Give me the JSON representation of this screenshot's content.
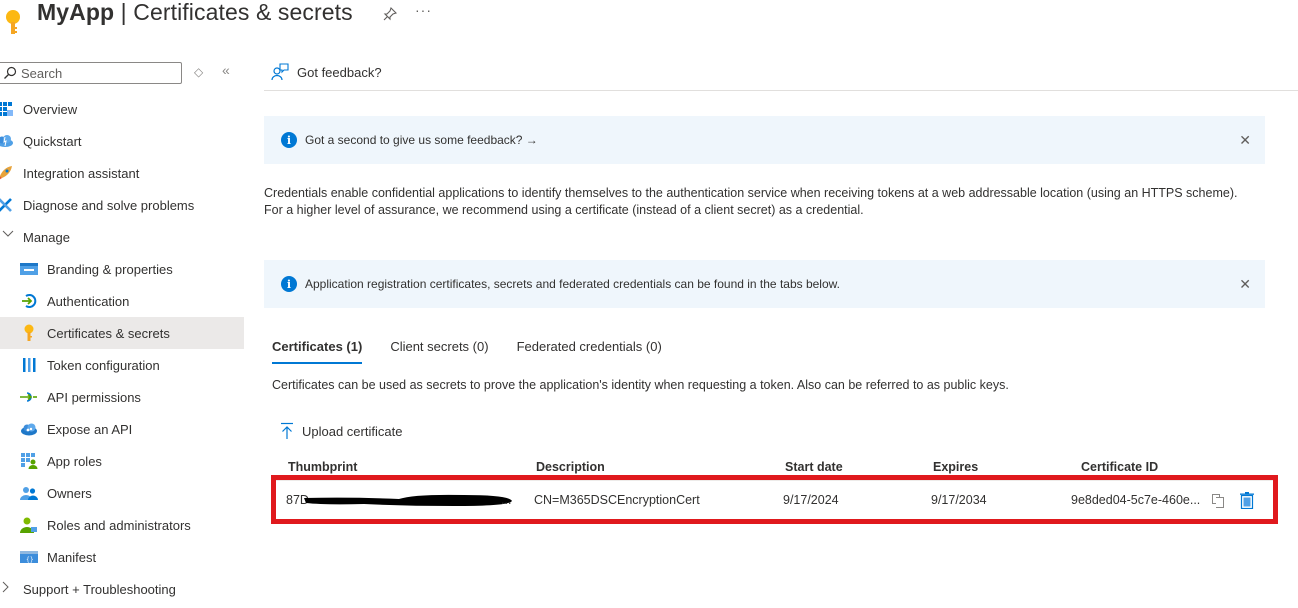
{
  "header": {
    "app_name": "MyApp",
    "separator": " | ",
    "page_title": "Certificates & secrets",
    "icons": {
      "app": "key-icon",
      "pin": "pin-icon",
      "more": "more-icon"
    },
    "more_label": "···"
  },
  "sidebar": {
    "search": {
      "placeholder": "Search",
      "value": ""
    },
    "updown_label": "◇",
    "collapse_label": "«",
    "items": [
      {
        "label": "Overview",
        "icon": "overview-grid-icon",
        "level": 0
      },
      {
        "label": "Quickstart",
        "icon": "quickstart-cloud-icon",
        "level": 0
      },
      {
        "label": "Integration assistant",
        "icon": "rocket-icon",
        "level": 0
      },
      {
        "label": "Diagnose and solve problems",
        "icon": "wrench-icon",
        "level": 0
      },
      {
        "label": "Manage",
        "icon": "chevron-down-icon",
        "level": 0,
        "expanded": true
      },
      {
        "label": "Branding & properties",
        "icon": "branding-icon",
        "level": 1
      },
      {
        "label": "Authentication",
        "icon": "authentication-icon",
        "level": 1
      },
      {
        "label": "Certificates & secrets",
        "icon": "key-icon",
        "level": 1,
        "selected": true
      },
      {
        "label": "Token configuration",
        "icon": "token-bars-icon",
        "level": 1
      },
      {
        "label": "API permissions",
        "icon": "api-permissions-icon",
        "level": 1
      },
      {
        "label": "Expose an API",
        "icon": "expose-api-cloud-icon",
        "level": 1
      },
      {
        "label": "App roles",
        "icon": "app-roles-icon",
        "level": 1
      },
      {
        "label": "Owners",
        "icon": "owners-icon",
        "level": 1
      },
      {
        "label": "Roles and administrators",
        "icon": "roles-admins-icon",
        "level": 1
      },
      {
        "label": "Manifest",
        "icon": "manifest-icon",
        "level": 1
      },
      {
        "label": "Support + Troubleshooting",
        "icon": "chevron-right-icon",
        "level": 0,
        "expanded": false
      }
    ]
  },
  "main": {
    "feedback_label": "Got feedback?",
    "banner_feedback": {
      "text": "Got a second to give us some feedback? →",
      "close": "✕"
    },
    "description": "Credentials enable confidential applications to identify themselves to the authentication service when receiving tokens at a web addressable location (using an HTTPS scheme). For a higher level of assurance, we recommend using a certificate (instead of a client secret) as a credential.",
    "banner_info": {
      "text": "Application registration certificates, secrets and federated credentials can be found in the tabs below.",
      "close": "✕"
    },
    "tabs": [
      {
        "label": "Certificates (1)",
        "active": true
      },
      {
        "label": "Client secrets (0)",
        "active": false
      },
      {
        "label": "Federated credentials (0)",
        "active": false
      }
    ],
    "tab_description": "Certificates can be used as secrets to prove the application's identity when requesting a token. Also can be referred to as public keys.",
    "upload_label": "Upload certificate",
    "table": {
      "columns": [
        "Thumbprint",
        "Description",
        "Start date",
        "Expires",
        "Certificate ID"
      ],
      "rows": [
        {
          "thumbprint": "87D",
          "thumbprint_suffix": "...",
          "thumbprint_redacted": true,
          "description": "CN=M365DSCEncryptionCert",
          "start_date": "9/17/2024",
          "expires": "9/17/2034",
          "certificate_id": "9e8ded04-5c7e-460e...",
          "highlighted": true
        }
      ]
    }
  },
  "colors": {
    "accent": "#0078d4",
    "banner_bg": "#eff6fc",
    "selected_nav": "#ebe9e8",
    "highlight_border": "#e0191d",
    "key_yellow": "#fcb813"
  }
}
